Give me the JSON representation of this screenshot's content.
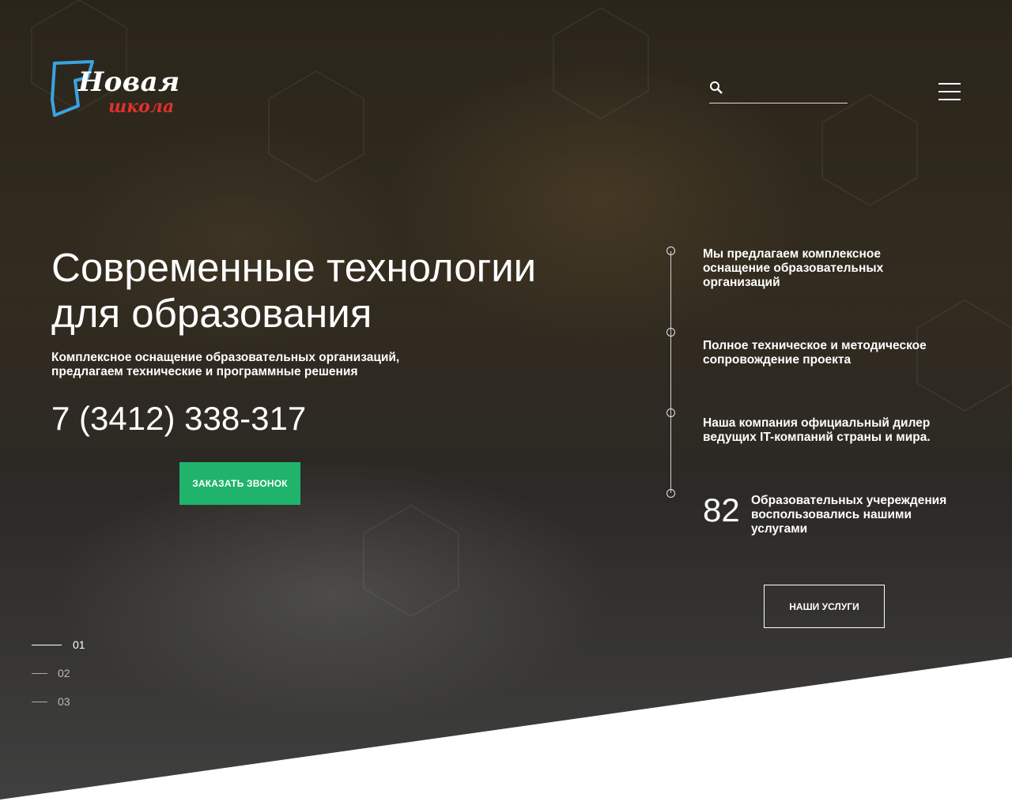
{
  "logo": {
    "word": "Новая",
    "sub": "школа",
    "frame_color": "#3aa3e0",
    "sub_color": "#e0312c"
  },
  "search": {
    "placeholder": "",
    "icon": "search-icon"
  },
  "menu": {
    "icon": "hamburger-menu-icon"
  },
  "hero": {
    "title_line1": "Современные технологии",
    "title_line2": "для образования",
    "subtitle_line1": "Комплексное оснащение образовательных организаций,",
    "subtitle_line2": "предлагаем технические и программные решения",
    "phone": "7 (3412) 338-317",
    "call_button": "ЗАКАЗАТЬ ЗВОНОК"
  },
  "features": [
    {
      "line1": "Мы предлагаем комплексное",
      "line2": "оснащение образовательных",
      "line3": "организаций"
    },
    {
      "line1": "Полное техническое и методическое",
      "line2": "сопровождение проекта"
    },
    {
      "line1": "Наша компания официальный дилер",
      "line2": "ведущих IT-компаний страны и мира."
    }
  ],
  "stat": {
    "number": "82",
    "line1": "Образовательных учереждения",
    "line2": "воспользовались нашими",
    "line3": "услугами"
  },
  "services_button": "НАШИ УСЛУГИ",
  "slides": [
    "01",
    "02",
    "03"
  ],
  "active_slide": "01",
  "colors": {
    "accent_green": "#1fb36c",
    "text": "#ffffff"
  }
}
